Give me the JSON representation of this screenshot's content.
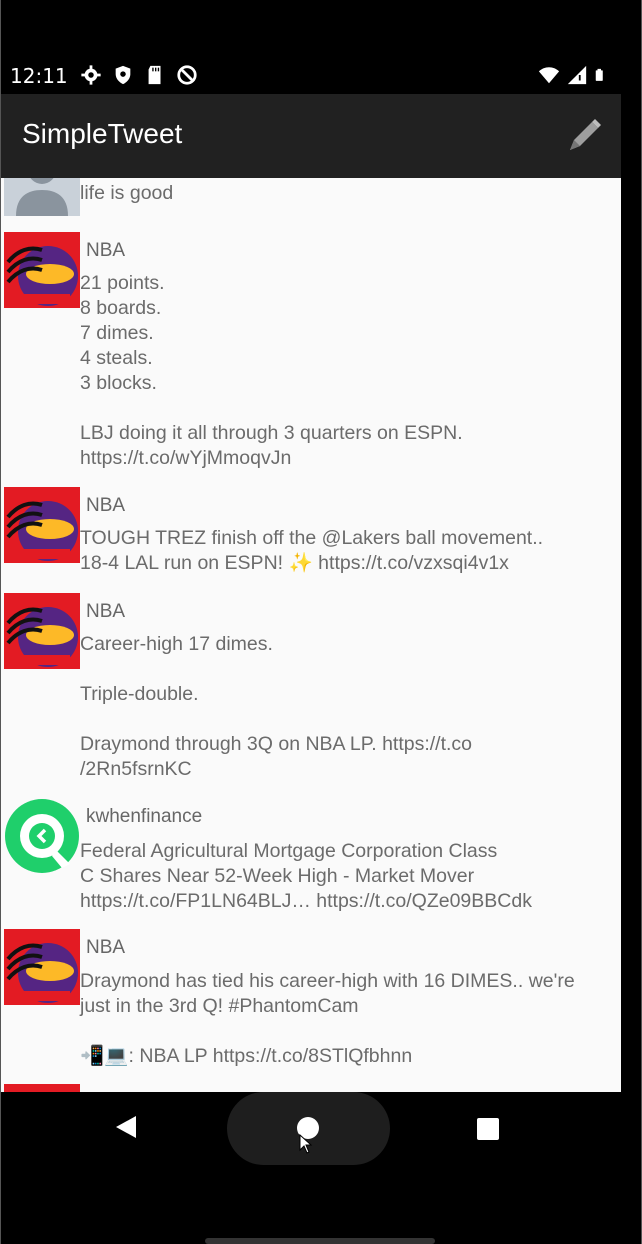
{
  "status_bar": {
    "time": "12:11",
    "left_icons": [
      "gear-icon",
      "shield-icon",
      "sd-card-icon",
      "vpn-icon"
    ],
    "right_icons": [
      "wifi-icon",
      "signal-icon",
      "battery-icon"
    ]
  },
  "app_bar": {
    "title": "SimpleTweet",
    "compose_icon": "pencil-icon",
    "background": "#212121"
  },
  "tweets": [
    {
      "handle": "",
      "avatar": "default-user-avatar",
      "body": "life is good"
    },
    {
      "handle": "NBA",
      "avatar": "nba-lakers-avatar",
      "body": "21 points.\n8 boards.\n7 dimes.\n4 steals.\n3 blocks.\n\nLBJ doing it all through 3 quarters on ESPN.\nhttps://t.co/wYjMmoqvJn"
    },
    {
      "handle": "NBA",
      "avatar": "nba-lakers-avatar",
      "body": "TOUGH TREZ finish off the @Lakers ball movement..\n18-4 LAL run on ESPN! ✨ https://t.co/vzxsqi4v1x"
    },
    {
      "handle": "NBA",
      "avatar": "nba-lakers-avatar",
      "body": "Career-high 17 dimes.\n\nTriple-double.\n\nDraymond through 3Q on NBA LP. https://t.co\n/2Rn5fsrnKC"
    },
    {
      "handle": "kwhenfinance",
      "avatar": "kwhen-logo-avatar",
      "body": "Federal Agricultural Mortgage Corporation Class\nC Shares Near 52-Week High - Market Mover\nhttps://t.co/FP1LN64BLJ… https://t.co/QZe09BBCdk"
    },
    {
      "handle": "NBA",
      "avatar": "nba-lakers-avatar",
      "body": "Draymond has tied his career-high with 16 DIMES.. we're\njust in the 3rd Q! #PhantomCam\n\n📲💻: NBA LP https://t.co/8STlQfbhnn"
    }
  ],
  "nav_bar": {
    "back_icon": "back-triangle-icon",
    "home_icon": "home-circle-icon",
    "recents_icon": "recents-square-icon"
  }
}
